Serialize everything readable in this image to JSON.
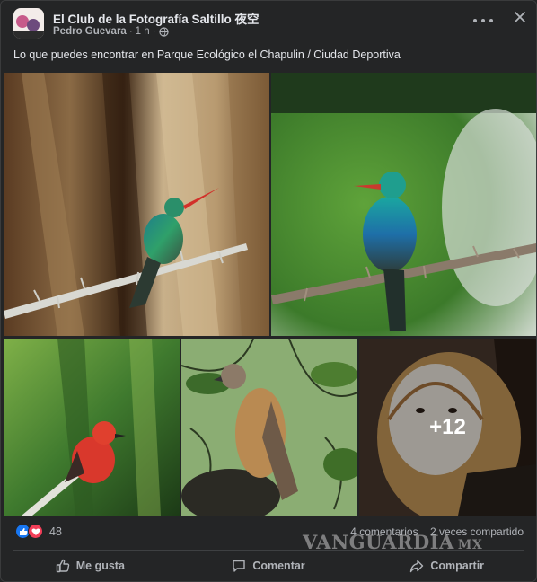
{
  "post": {
    "group_name": "El Club de la Fotografía Saltillo 夜空",
    "author": "Pedro Guevara",
    "time": "1 h",
    "separator": "·",
    "text": "Lo que puedes encontrar en Parque Ecológico el Chapulin / Ciudad Deportiva",
    "more_photos": "+12"
  },
  "stats": {
    "reaction_count": "48",
    "comments": "4 comentarios",
    "shares": "2 veces compartido"
  },
  "actions": {
    "like": "Me gusta",
    "comment": "Comentar",
    "share": "Compartir"
  },
  "watermark": {
    "text": "VANGUARDIA",
    "suffix": "MX"
  },
  "icons": {
    "privacy": "globe-icon",
    "menu": "more-icon",
    "close": "close-icon",
    "like_reaction": "like-reaction-icon",
    "love_reaction": "love-reaction-icon",
    "like_action": "thumbs-up-icon",
    "comment_action": "comment-icon",
    "share_action": "share-icon"
  },
  "colors": {
    "card_bg": "#242526",
    "text_primary": "#e4e6eb",
    "text_secondary": "#b0b3b8",
    "like_blue": "#1877f2",
    "love_red": "#f33e58"
  }
}
